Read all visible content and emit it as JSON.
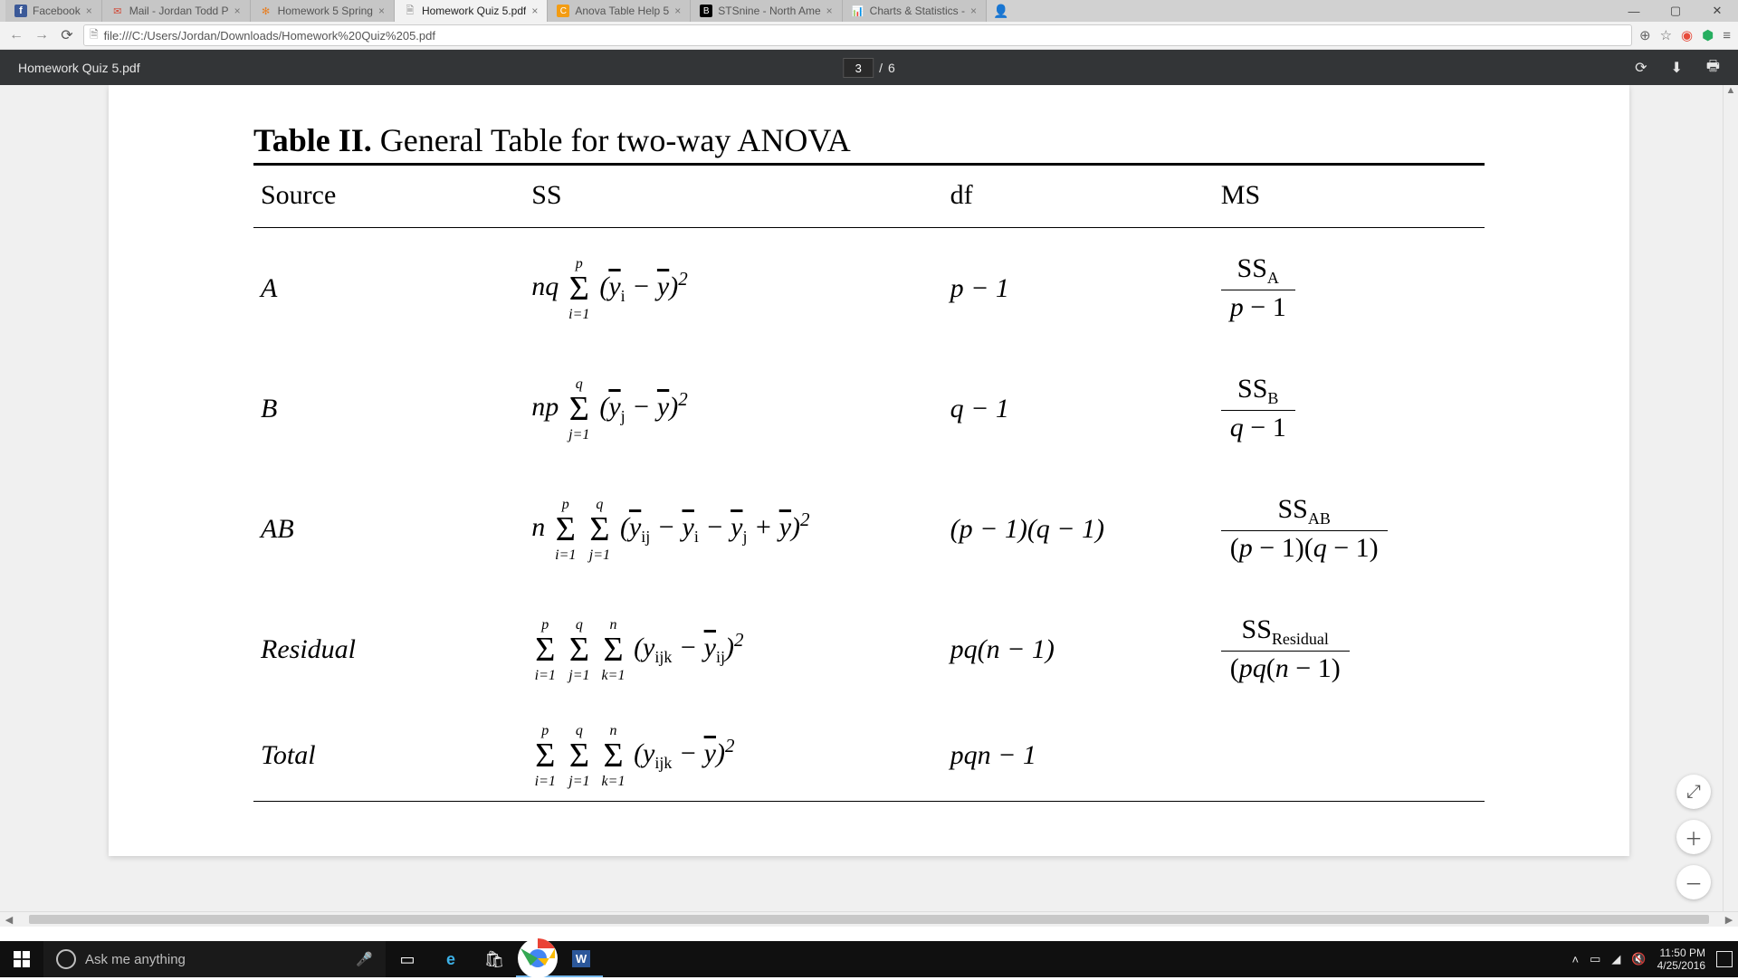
{
  "tabs": [
    {
      "title": "Facebook",
      "fav": "f"
    },
    {
      "title": "Mail - Jordan Todd P",
      "fav": "✉"
    },
    {
      "title": "Homework 5 Spring",
      "fav": "✻"
    },
    {
      "title": "Homework Quiz 5.pdf",
      "fav": "🗎",
      "active": true
    },
    {
      "title": "Anova Table Help 5",
      "fav": "C"
    },
    {
      "title": "STSnine - North Ame",
      "fav": "B"
    },
    {
      "title": "Charts & Statistics -",
      "fav": "📊"
    }
  ],
  "url": "file:///C:/Users/Jordan/Downloads/Homework%20Quiz%205.pdf",
  "pdf": {
    "filename": "Homework Quiz 5.pdf",
    "page": "3",
    "total": "6"
  },
  "doc": {
    "title_bold": "Table II.",
    "title_rest": " General Table for two-way ANOVA",
    "headers": {
      "source": "Source",
      "ss": "SS",
      "df": "df",
      "ms": "MS"
    },
    "rows": [
      {
        "source": "A",
        "ss": "nq Σ_{i=1}^{p} (ȳ_i − ȳ)²",
        "df": "p − 1",
        "ms": "SS_A / (p − 1)"
      },
      {
        "source": "B",
        "ss": "np Σ_{j=1}^{q} (ȳ_j − ȳ)²",
        "df": "q − 1",
        "ms": "SS_B / (q − 1)"
      },
      {
        "source": "AB",
        "ss": "n Σ_{i=1}^{p} Σ_{j=1}^{q} (ȳ_{ij} − ȳ_i − ȳ_j + ȳ)²",
        "df": "(p − 1)(q − 1)",
        "ms": "SS_AB / ((p − 1)(q − 1))"
      },
      {
        "source": "Residual",
        "ss": "Σ_{i=1}^{p} Σ_{j=1}^{q} Σ_{k=1}^{n} (y_{ijk} − ȳ_{ij})²",
        "df": "pq(n − 1)",
        "ms": "SS_Residual / (pq(n − 1))"
      },
      {
        "source": "Total",
        "ss": "Σ_{i=1}^{p} Σ_{j=1}^{q} Σ_{k=1}^{n} (y_{ijk} − ȳ)²",
        "df": "pqn − 1",
        "ms": ""
      }
    ]
  },
  "taskbar": {
    "search_placeholder": "Ask me anything",
    "time": "11:50 PM",
    "date": "4/25/2016"
  }
}
